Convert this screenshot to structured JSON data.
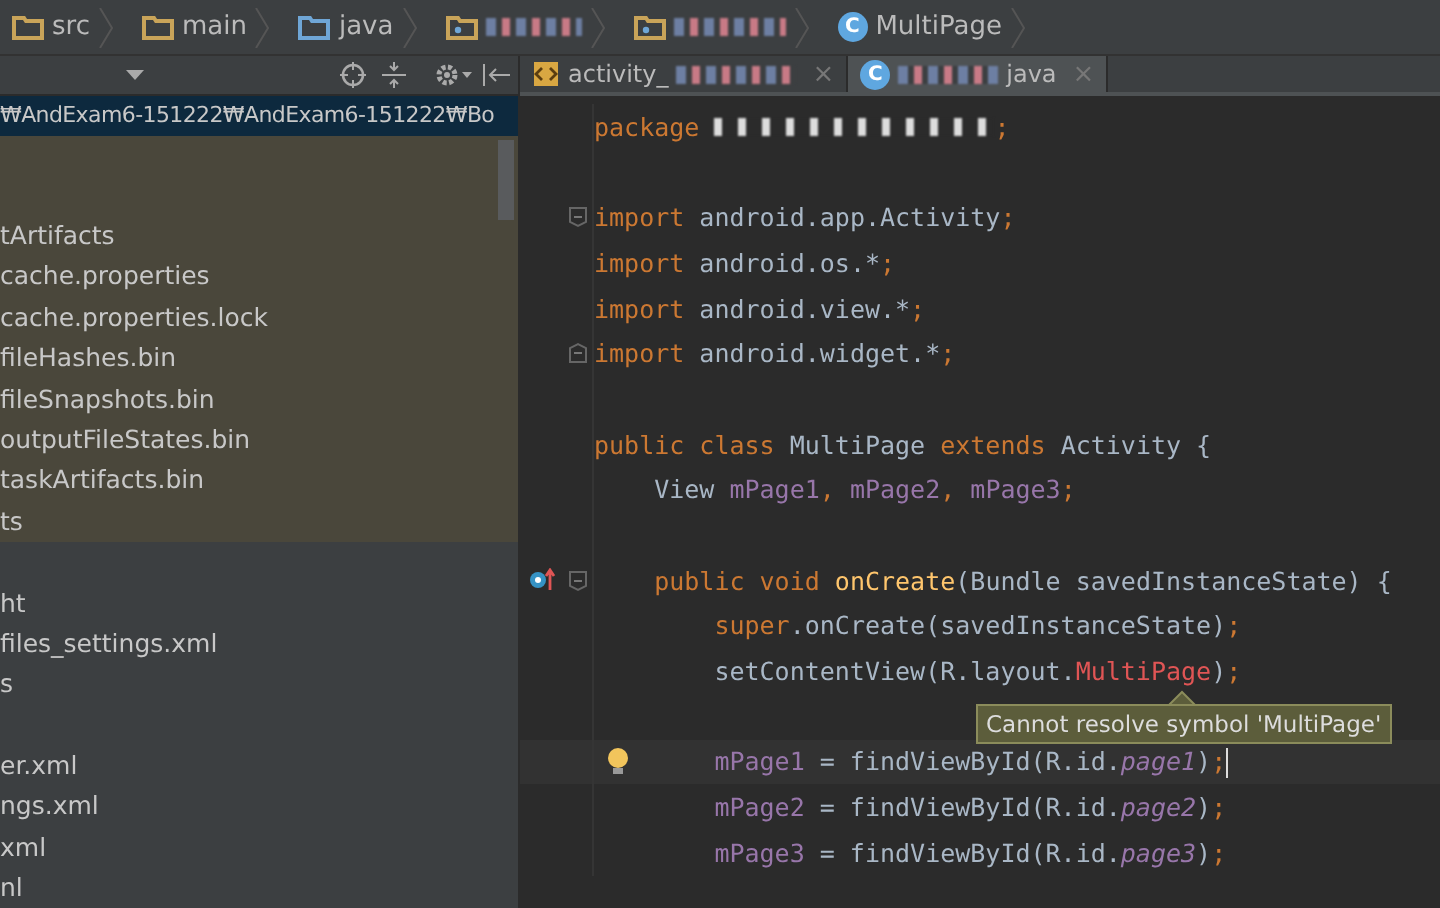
{
  "breadcrumbs": [
    {
      "kind": "folder",
      "label": "src"
    },
    {
      "kind": "folder",
      "label": "main"
    },
    {
      "kind": "source-folder",
      "label": "java"
    },
    {
      "kind": "package"
    },
    {
      "kind": "package"
    },
    {
      "kind": "class",
      "icon_letter": "C",
      "label": "MultiPage"
    }
  ],
  "project_panel": {
    "path": "₩AndExam6-151222₩AndExam6-151222₩Bo",
    "sections": [
      {
        "highlighted": true,
        "items": [
          "tArtifacts",
          "cache.properties",
          "cache.properties.lock",
          "fileHashes.bin",
          "fileSnapshots.bin",
          "outputFileStates.bin",
          "taskArtifacts.bin",
          "ts"
        ]
      },
      {
        "highlighted": false,
        "items": [
          "ht",
          "files_settings.xml",
          "s"
        ]
      },
      {
        "highlighted": false,
        "items": [
          "er.xml",
          "ngs.xml",
          "xml",
          "nl"
        ]
      }
    ]
  },
  "tabs": [
    {
      "kind": "layout",
      "label_start": "activity_",
      "close": "×",
      "selected": false
    },
    {
      "kind": "class",
      "icon_letter": "C",
      "label_end": "java",
      "close": "×",
      "selected": true
    }
  ],
  "editor": {
    "lines": [
      {
        "kind": "code",
        "tokens": [
          {
            "kind": "kw",
            "t": "package"
          },
          {
            "kind": "redacted"
          },
          {
            "kind": "kw",
            "t": ";"
          }
        ]
      },
      {
        "kind": "blank"
      },
      {
        "kind": "code",
        "fold_start": true,
        "tokens": [
          {
            "kind": "kw",
            "t": "import"
          },
          {
            "kind": "plain",
            "t": " android.app.Activity"
          },
          {
            "kind": "kw",
            "t": ";"
          }
        ]
      },
      {
        "kind": "code",
        "tokens": [
          {
            "kind": "kw",
            "t": "import"
          },
          {
            "kind": "plain",
            "t": " android.os.*"
          },
          {
            "kind": "kw",
            "t": ";"
          }
        ]
      },
      {
        "kind": "code",
        "tokens": [
          {
            "kind": "kw",
            "t": "import"
          },
          {
            "kind": "plain",
            "t": " android.view.*"
          },
          {
            "kind": "kw",
            "t": ";"
          }
        ]
      },
      {
        "kind": "code",
        "fold_end": true,
        "tokens": [
          {
            "kind": "kw",
            "t": "import"
          },
          {
            "kind": "plain",
            "t": " android.widget.*"
          },
          {
            "kind": "kw",
            "t": ";"
          }
        ]
      },
      {
        "kind": "blank"
      },
      {
        "kind": "code",
        "tokens": [
          {
            "kind": "kw",
            "t": "public class "
          },
          {
            "kind": "plain",
            "t": "MultiPage "
          },
          {
            "kind": "kw",
            "t": "extends "
          },
          {
            "kind": "plain",
            "t": "Activity {"
          }
        ]
      },
      {
        "kind": "code",
        "tokens": [
          {
            "kind": "plain",
            "t": "    View "
          },
          {
            "kind": "field",
            "t": "mPage1"
          },
          {
            "kind": "kw",
            "t": ", "
          },
          {
            "kind": "field",
            "t": "mPage2"
          },
          {
            "kind": "kw",
            "t": ", "
          },
          {
            "kind": "field",
            "t": "mPage3"
          },
          {
            "kind": "kw",
            "t": ";"
          }
        ]
      },
      {
        "kind": "blank"
      },
      {
        "kind": "code",
        "fold_start": true,
        "override_marker": true,
        "tokens": [
          {
            "kind": "kw",
            "t": "    public void "
          },
          {
            "kind": "method",
            "t": "onCreate"
          },
          {
            "kind": "plain",
            "t": "(Bundle savedInstanceState) {"
          }
        ]
      },
      {
        "kind": "code",
        "tokens": [
          {
            "kind": "kw",
            "t": "        super"
          },
          {
            "kind": "plain",
            "t": ".onCreate(savedInstanceState)"
          },
          {
            "kind": "kw",
            "t": ";"
          }
        ]
      },
      {
        "kind": "code",
        "tokens": [
          {
            "kind": "plain",
            "t": "        setContentView(R.layout."
          },
          {
            "kind": "error",
            "t": "MultiPage"
          },
          {
            "kind": "plain",
            "t": ")"
          },
          {
            "kind": "kw",
            "t": ";"
          }
        ]
      },
      {
        "kind": "blank"
      },
      {
        "kind": "code",
        "intention_bulb": true,
        "current": true,
        "tokens": [
          {
            "kind": "field",
            "t": "        mPage1"
          },
          {
            "kind": "plain",
            "t": " = findViewById(R.id."
          },
          {
            "kind": "italic",
            "t": "page1"
          },
          {
            "kind": "plain",
            "t": ")"
          },
          {
            "kind": "kw",
            "t": ";"
          }
        ]
      },
      {
        "kind": "code",
        "tokens": [
          {
            "kind": "field",
            "t": "        mPage2"
          },
          {
            "kind": "plain",
            "t": " = findViewById(R.id."
          },
          {
            "kind": "italic",
            "t": "page2"
          },
          {
            "kind": "plain",
            "t": ")"
          },
          {
            "kind": "kw",
            "t": ";"
          }
        ]
      },
      {
        "kind": "code",
        "tokens": [
          {
            "kind": "field",
            "t": "        mPage3"
          },
          {
            "kind": "plain",
            "t": " = findViewById(R.id."
          },
          {
            "kind": "italic",
            "t": "page3"
          },
          {
            "kind": "plain",
            "t": ")"
          },
          {
            "kind": "kw",
            "t": ";"
          }
        ]
      }
    ],
    "tooltip": "Cannot resolve symbol 'MultiPage'"
  }
}
